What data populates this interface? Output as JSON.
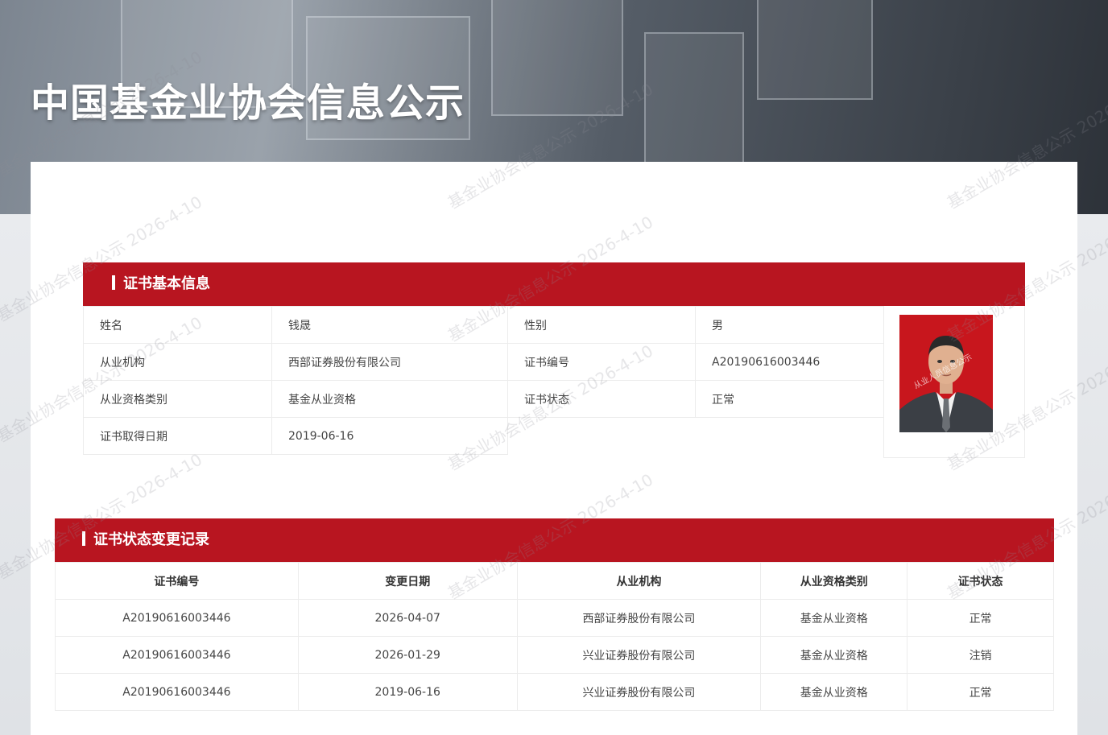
{
  "header": {
    "title": "中国基金业协会信息公示"
  },
  "basic_info": {
    "section_title": "证书基本信息",
    "rows": [
      {
        "label1": "姓名",
        "value1": "钱晟",
        "label2": "性别",
        "value2": "男"
      },
      {
        "label1": "从业机构",
        "value1": "西部证券股份有限公司",
        "label2": "证书编号",
        "value2": "A20190616003446"
      },
      {
        "label1": "从业资格类别",
        "value1": "基金从业资格",
        "label2": "证书状态",
        "value2": "正常"
      },
      {
        "label1": "证书取得日期",
        "value1": "2019-06-16"
      }
    ],
    "photo_watermark": "从业人员信息公示"
  },
  "records": {
    "section_title": "证书状态变更记录",
    "columns": [
      "证书编号",
      "变更日期",
      "从业机构",
      "从业资格类别",
      "证书状态"
    ],
    "rows": [
      [
        "A20190616003446",
        "2026-04-07",
        "西部证券股份有限公司",
        "基金从业资格",
        "正常"
      ],
      [
        "A20190616003446",
        "2026-01-29",
        "兴业证券股份有限公司",
        "基金从业资格",
        "注销"
      ],
      [
        "A20190616003446",
        "2019-06-16",
        "兴业证券股份有限公司",
        "基金从业资格",
        "正常"
      ]
    ]
  },
  "watermark": {
    "text": "基金业协会信息公示 2026-4-10"
  },
  "colors": {
    "accent": "#b81520"
  }
}
